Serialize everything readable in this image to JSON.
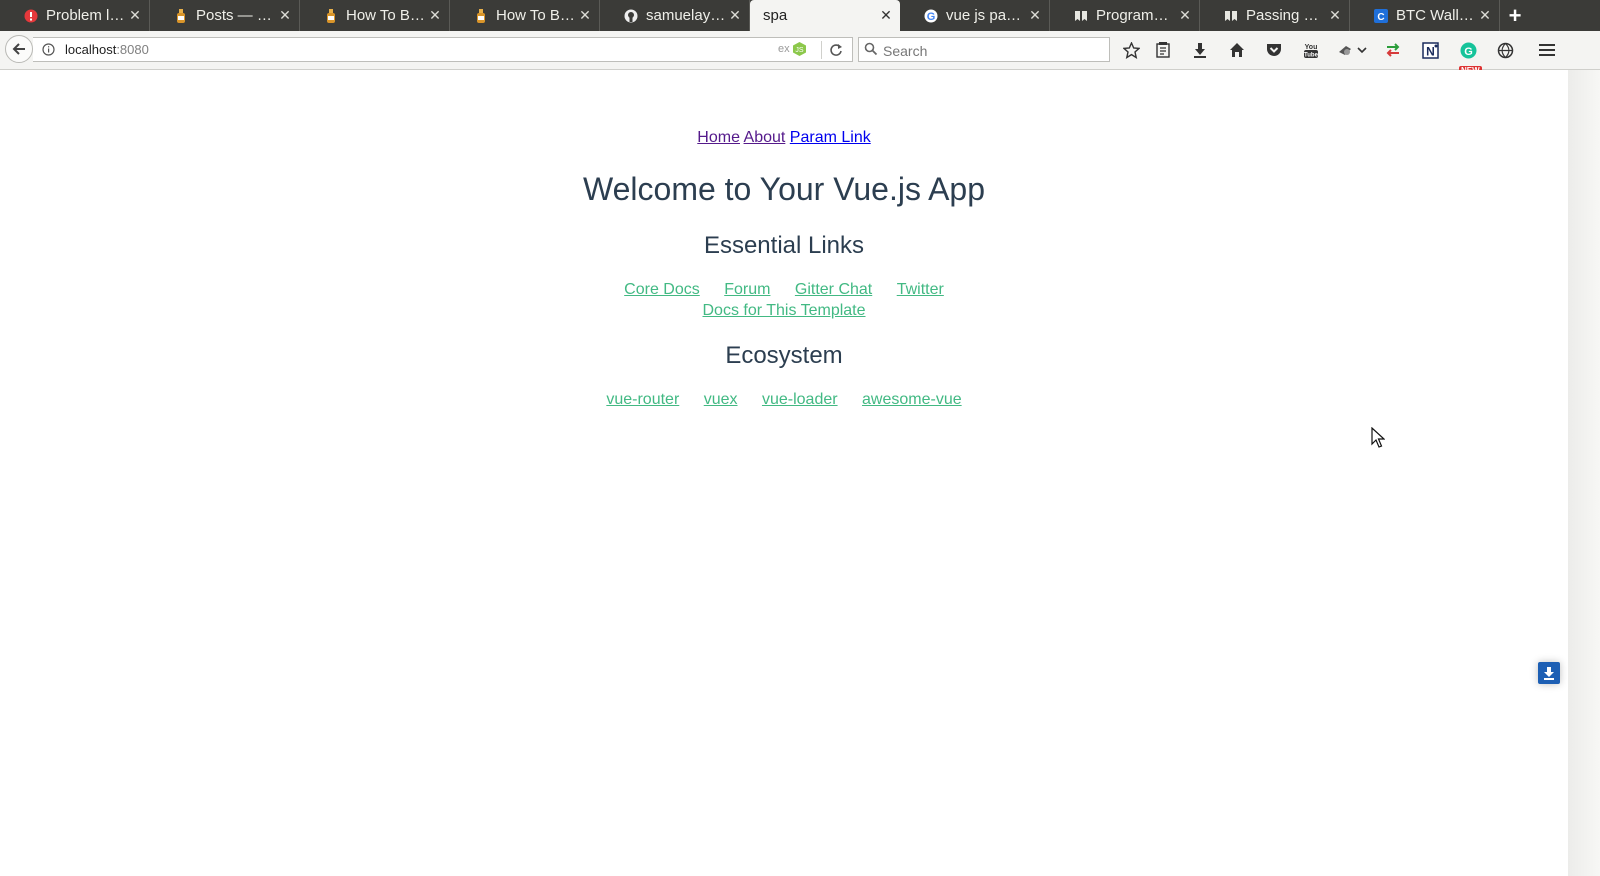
{
  "browser": {
    "tabs": [
      {
        "title": "Problem lo…",
        "icon": "error-icon",
        "active": false
      },
      {
        "title": "Posts — Sc…",
        "icon": "scotch-icon",
        "active": false
      },
      {
        "title": "How To Bui…",
        "icon": "scotch-icon",
        "active": false
      },
      {
        "title": "How To Bui…",
        "icon": "scotch-icon",
        "active": false
      },
      {
        "title": "samuelayo/…",
        "icon": "github-icon",
        "active": false
      },
      {
        "title": "spa",
        "icon": "",
        "active": true
      },
      {
        "title": "vue js pass …",
        "icon": "google-icon",
        "active": false
      },
      {
        "title": "Programm…",
        "icon": "bookmark-icon",
        "active": false
      },
      {
        "title": "Passing Pro…",
        "icon": "bookmark-icon",
        "active": false
      },
      {
        "title": "BTC Wallet …",
        "icon": "coinbase-icon",
        "active": false
      }
    ],
    "url": {
      "host": "localhost",
      "port": ":8080"
    },
    "ext_label": "ex",
    "search_placeholder": "Search",
    "new_badge": "NEW"
  },
  "page": {
    "nav": {
      "home": "Home",
      "about": "About",
      "param": "Param Link"
    },
    "title": "Welcome to Your Vue.js App",
    "essential": {
      "heading": "Essential Links",
      "links": [
        "Core Docs",
        "Forum",
        "Gitter Chat",
        "Twitter",
        "Docs for This Template"
      ]
    },
    "ecosystem": {
      "heading": "Ecosystem",
      "links": [
        "vue-router",
        "vuex",
        "vue-loader",
        "awesome-vue"
      ]
    }
  },
  "colors": {
    "text": "#2c3e50",
    "link": "#42b983",
    "visited": "#551a8b",
    "unvisited": "#0000ee",
    "tabstrip": "#3b3b38"
  }
}
